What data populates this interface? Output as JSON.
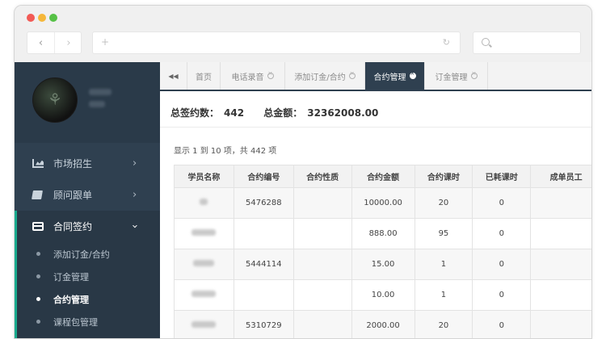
{
  "browser": {
    "nav_back": "‹",
    "nav_forward": "›",
    "url_icon": "+",
    "reload_icon": "↻"
  },
  "sidebar": {
    "menu": [
      {
        "label": "市场招生",
        "icon": "chart-icon"
      },
      {
        "label": "顾问跟单",
        "icon": "book-icon"
      },
      {
        "label": "合同签约",
        "icon": "card-icon"
      }
    ],
    "submenu": [
      {
        "label": "添加订金/合约"
      },
      {
        "label": "订金管理"
      },
      {
        "label": "合约管理"
      },
      {
        "label": "课程包管理"
      }
    ]
  },
  "tabs": {
    "back_icon": "◀◀",
    "items": [
      {
        "label": "首页"
      },
      {
        "label": "电话录音"
      },
      {
        "label": "添加订金/合约"
      },
      {
        "label": "合约管理"
      },
      {
        "label": "订金管理"
      }
    ],
    "active_index": 3
  },
  "summary": {
    "count_label": "总签约数：",
    "count_value": "442",
    "amount_label": "总金额：",
    "amount_value": "32362008.00"
  },
  "pagination_info": "显示 1 到 10 项，共 442 项",
  "table": {
    "headers": [
      "学员名称",
      "合约编号",
      "合约性质",
      "合约金额",
      "合约课时",
      "已耗课时",
      "成单员工"
    ],
    "rows": [
      {
        "contract_no": "5476288",
        "nature": "",
        "amount": "10000.00",
        "hours": "20",
        "used": "0",
        "staff": ""
      },
      {
        "contract_no": "",
        "nature": "",
        "amount": "888.00",
        "hours": "95",
        "used": "0",
        "staff": ""
      },
      {
        "contract_no": "5444114",
        "nature": "",
        "amount": "15.00",
        "hours": "1",
        "used": "0",
        "staff": ""
      },
      {
        "contract_no": "",
        "nature": "",
        "amount": "10.00",
        "hours": "1",
        "used": "0",
        "staff": ""
      },
      {
        "contract_no": "5310729",
        "nature": "",
        "amount": "2000.00",
        "hours": "20",
        "used": "0",
        "staff": ""
      }
    ]
  },
  "colors": {
    "sidebar_bg": "#2f4050",
    "accent": "#19aa8d",
    "active_tab": "#2f4050"
  }
}
